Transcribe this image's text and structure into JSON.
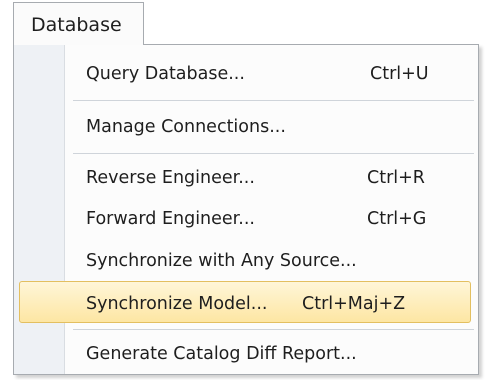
{
  "menu": {
    "title": "Database",
    "items": [
      {
        "label": "Query Database...",
        "shortcut": "Ctrl+U"
      },
      {
        "label": "Manage Connections...",
        "shortcut": ""
      },
      {
        "label": "Reverse Engineer...",
        "shortcut": "Ctrl+R"
      },
      {
        "label": "Forward Engineer...",
        "shortcut": "Ctrl+G"
      },
      {
        "label": "Synchronize with Any Source...",
        "shortcut": ""
      },
      {
        "label": "Synchronize Model...",
        "shortcut": "Ctrl+Maj+Z",
        "highlighted": true
      },
      {
        "label": "Generate Catalog Diff Report...",
        "shortcut": ""
      }
    ]
  }
}
